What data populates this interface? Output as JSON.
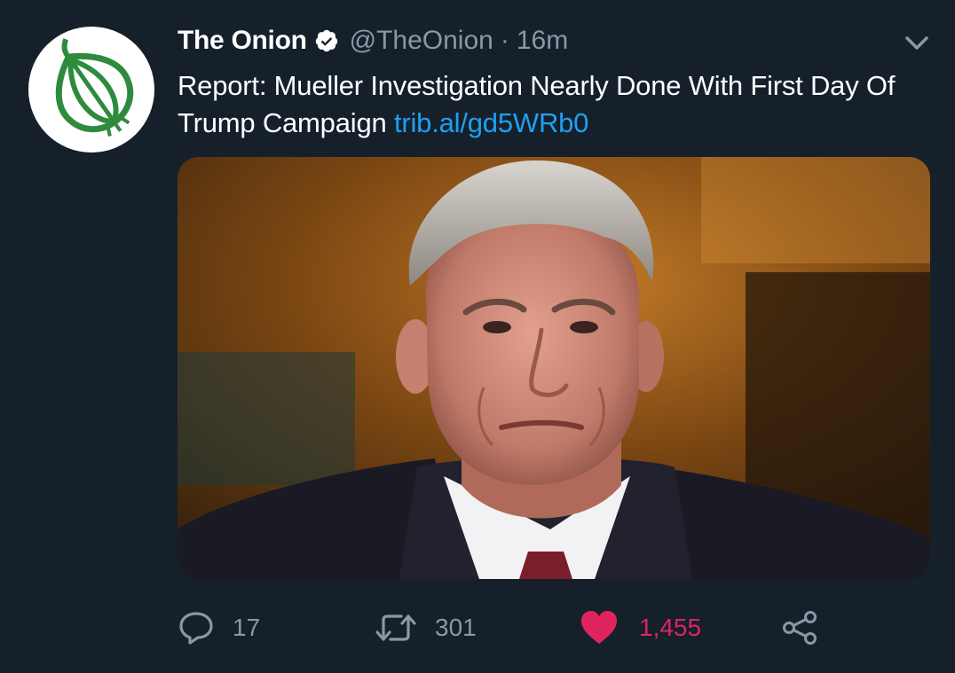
{
  "tweet": {
    "display_name": "The Onion",
    "verified_icon": "verified-badge-icon",
    "handle": "@TheOnion",
    "separator": "·",
    "timestamp": "16m",
    "text": "Report: Mueller Investigation Nearly Done With First Day Of Trump Campaign ",
    "link": "trib.al/gd5WRb0"
  },
  "actions": {
    "reply": {
      "icon": "reply-icon",
      "count": "17"
    },
    "retweet": {
      "icon": "retweet-icon",
      "count": "301"
    },
    "like": {
      "icon": "heart-icon",
      "count": "1,455",
      "color": "#e0245e"
    },
    "share": {
      "icon": "share-icon"
    }
  },
  "colors": {
    "background": "#15202b",
    "text": "#ffffff",
    "secondary": "#8899a6",
    "link": "#1da1f2",
    "onion_green": "#2e8b3e"
  }
}
